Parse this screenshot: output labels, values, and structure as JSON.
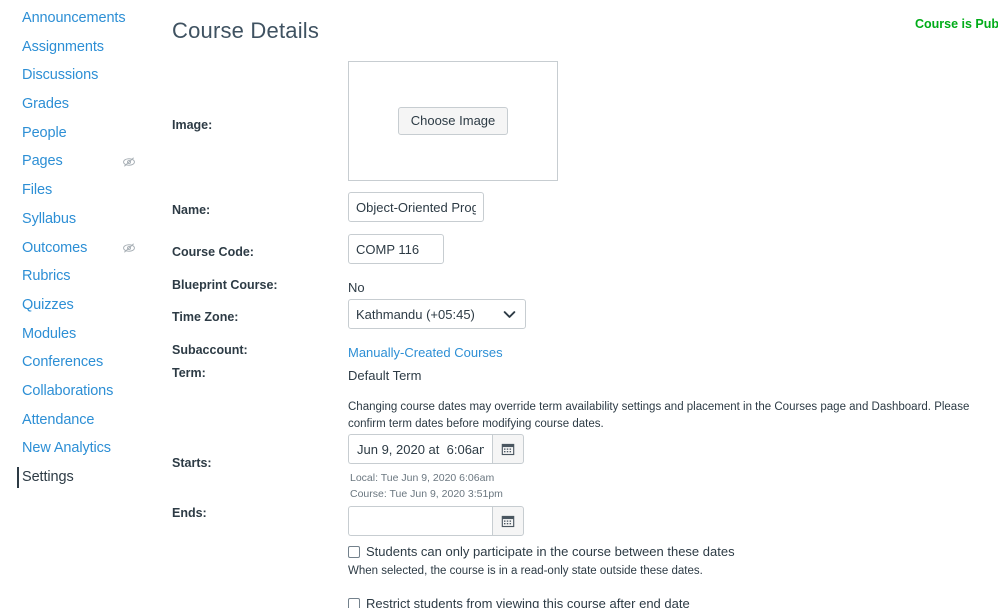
{
  "sidebar": {
    "items": [
      {
        "label": "Announcements",
        "active": false,
        "hidden_icon": false
      },
      {
        "label": "Assignments",
        "active": false,
        "hidden_icon": false
      },
      {
        "label": "Discussions",
        "active": false,
        "hidden_icon": false
      },
      {
        "label": "Grades",
        "active": false,
        "hidden_icon": false
      },
      {
        "label": "People",
        "active": false,
        "hidden_icon": false
      },
      {
        "label": "Pages",
        "active": false,
        "hidden_icon": true
      },
      {
        "label": "Files",
        "active": false,
        "hidden_icon": false
      },
      {
        "label": "Syllabus",
        "active": false,
        "hidden_icon": false
      },
      {
        "label": "Outcomes",
        "active": false,
        "hidden_icon": true
      },
      {
        "label": "Rubrics",
        "active": false,
        "hidden_icon": false
      },
      {
        "label": "Quizzes",
        "active": false,
        "hidden_icon": false
      },
      {
        "label": "Modules",
        "active": false,
        "hidden_icon": false
      },
      {
        "label": "Conferences",
        "active": false,
        "hidden_icon": false
      },
      {
        "label": "Collaborations",
        "active": false,
        "hidden_icon": false
      },
      {
        "label": "Attendance",
        "active": false,
        "hidden_icon": false
      },
      {
        "label": "New Analytics",
        "active": false,
        "hidden_icon": false
      },
      {
        "label": "Settings",
        "active": true,
        "hidden_icon": false
      }
    ]
  },
  "header": {
    "title": "Course Details",
    "publish_status": "Course is Published"
  },
  "form": {
    "image": {
      "label": "Image:",
      "button_label": "Choose Image"
    },
    "name": {
      "label": "Name:",
      "value": "Object-Oriented Programming"
    },
    "course_code": {
      "label": "Course Code:",
      "value": "COMP 116"
    },
    "blueprint": {
      "label": "Blueprint Course:",
      "value": "No"
    },
    "time_zone": {
      "label": "Time Zone:",
      "value": "Kathmandu (+05:45)",
      "options": [
        "Kathmandu (+05:45)"
      ]
    },
    "subaccount": {
      "label": "Subaccount:",
      "value": "Manually-Created Courses"
    },
    "term": {
      "label": "Term:",
      "value": "Default Term"
    },
    "dates_warning": "Changing course dates may override term availability settings and placement in the Courses page and Dashboard. Please confirm term dates before modifying course dates.",
    "starts": {
      "label": "Starts:",
      "value": "Jun 9, 2020 at  6:06am",
      "placeholder": "",
      "local_hint": "Local: Tue Jun 9, 2020 6:06am",
      "course_hint": "Course: Tue Jun 9, 2020 3:51pm"
    },
    "ends": {
      "label": "Ends:",
      "value": "",
      "placeholder": ""
    },
    "restrict_participation": {
      "label": "Students can only participate in the course between these dates",
      "checked": false,
      "help": "When selected, the course is in a read-only state outside these dates."
    },
    "restrict_view_after_end": {
      "label": "Restrict students from viewing this course after end date",
      "checked": false
    }
  },
  "colors": {
    "link": "#2D8FD5",
    "text": "#2D3B45",
    "published": "#00AC18",
    "border": "#C7CDD1"
  }
}
